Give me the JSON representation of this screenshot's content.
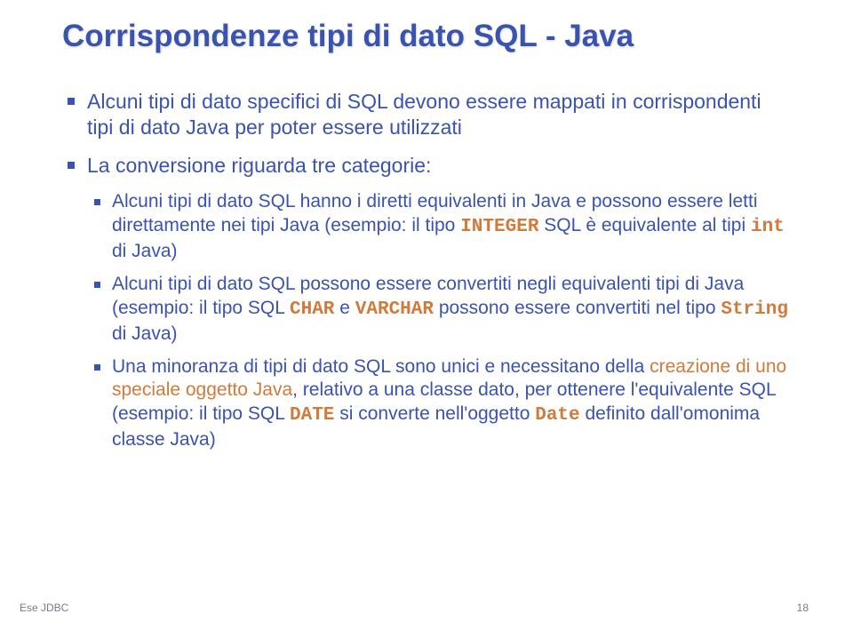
{
  "title": "Corrispondenze tipi di dato SQL - Java",
  "b1a": "Alcuni tipi di dato specifici di SQL devono essere mappati in corrispondenti tipi di dato Java per poter essere utilizzati",
  "b1b": "La conversione riguarda tre categorie:",
  "b2a_1": "Alcuni tipi di dato SQL hanno i diretti equivalenti in Java e possono essere letti direttamente nei tipi Java (esempio: il tipo ",
  "b2a_code1": "INTEGER",
  "b2a_2": " SQL è equivalente al tipi ",
  "b2a_code2": "int",
  "b2a_3": " di Java)",
  "b2b_1": "Alcuni tipi di dato SQL possono essere convertiti negli equivalenti tipi di Java (esempio: il tipo SQL ",
  "b2b_code1": "CHAR",
  "b2b_2": " e ",
  "b2b_code2": "VARCHAR",
  "b2b_3": " possono essere convertiti nel tipo ",
  "b2b_code3": "String",
  "b2b_4": " di Java)",
  "b2c_1": "Una minoranza di tipi di dato SQL sono unici e necessitano della ",
  "b2c_sp": "creazione di uno speciale oggetto Java",
  "b2c_2": ", relativo a una classe dato, per ottenere l'equivalente SQL (esempio: il tipo SQL ",
  "b2c_code1": "DATE",
  "b2c_3": " si converte nell'oggetto ",
  "b2c_code2": "Date",
  "b2c_4": " definito dall'omonima classe Java)",
  "footer_left": "Ese JDBC",
  "footer_right": "18"
}
